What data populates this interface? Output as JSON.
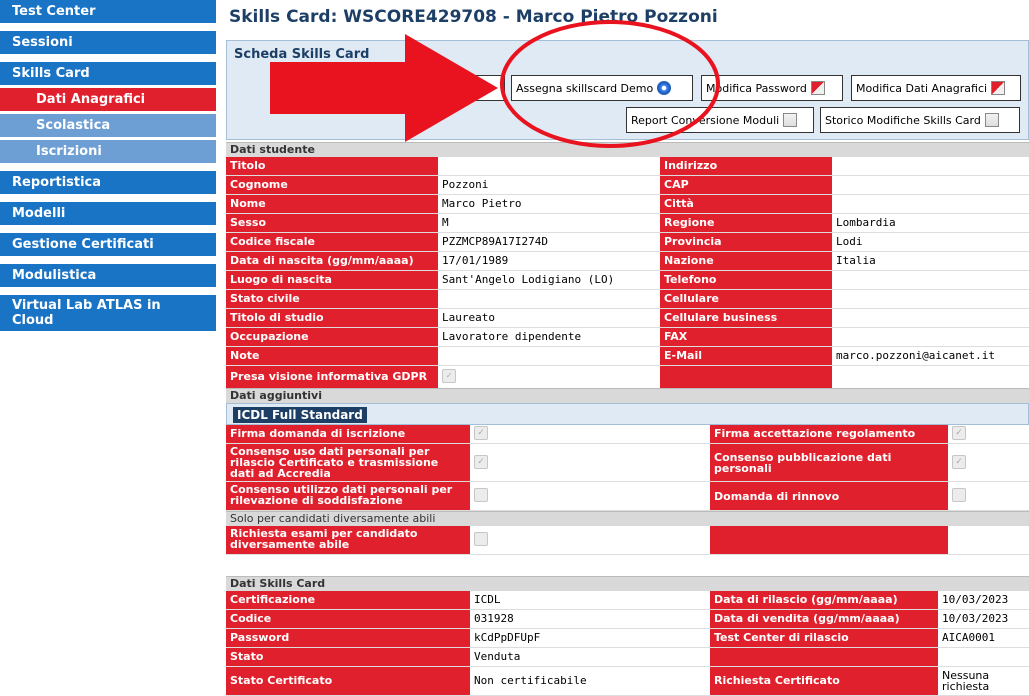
{
  "sidebar": {
    "items": [
      {
        "label": "Test Center"
      },
      {
        "label": "Sessioni"
      },
      {
        "label": "Skills Card"
      },
      {
        "label": "Dati Anagrafici"
      },
      {
        "label": "Scolastica"
      },
      {
        "label": "Iscrizioni"
      },
      {
        "label": "Reportistica"
      },
      {
        "label": "Modelli"
      },
      {
        "label": "Gestione Certificati"
      },
      {
        "label": "Modulistica"
      },
      {
        "label": "Virtual Lab ATLAS in Cloud"
      }
    ]
  },
  "page_title": "Skills Card: WSCORE429708 - Marco Pietro Pozzoni",
  "card": {
    "title": "Scheda Skills Card",
    "buttons": {
      "demo": "Assegna skillscard Demo",
      "password": "Modifica Password",
      "anagrafici": "Modifica Dati Anagrafici",
      "report": "Report Conversione Moduli",
      "storico": "Storico Modifiche Skills Card"
    }
  },
  "dati_studente": {
    "header": "Dati studente",
    "left": [
      {
        "label": "Titolo",
        "value": ""
      },
      {
        "label": "Cognome",
        "value": "Pozzoni"
      },
      {
        "label": "Nome",
        "value": "Marco Pietro"
      },
      {
        "label": "Sesso",
        "value": "M"
      },
      {
        "label": "Codice fiscale",
        "value": "PZZMCP89A17I274D"
      },
      {
        "label": "Data di nascita (gg/mm/aaaa)",
        "value": "17/01/1989"
      },
      {
        "label": "Luogo di nascita",
        "value": "Sant'Angelo Lodigiano (LO)"
      },
      {
        "label": "Stato civile",
        "value": ""
      },
      {
        "label": "Titolo di studio",
        "value": "Laureato"
      },
      {
        "label": "Occupazione",
        "value": "Lavoratore dipendente"
      },
      {
        "label": "Note",
        "value": ""
      }
    ],
    "right": [
      {
        "label": "Indirizzo",
        "value": ""
      },
      {
        "label": "CAP",
        "value": ""
      },
      {
        "label": "Città",
        "value": ""
      },
      {
        "label": "Regione",
        "value": "Lombardia"
      },
      {
        "label": "Provincia",
        "value": "Lodi"
      },
      {
        "label": "Nazione",
        "value": "Italia"
      },
      {
        "label": "Telefono",
        "value": ""
      },
      {
        "label": "Cellulare",
        "value": ""
      },
      {
        "label": "Cellulare business",
        "value": ""
      },
      {
        "label": "FAX",
        "value": ""
      },
      {
        "label": "E-Mail",
        "value": "marco.pozzoni@aicanet.it"
      }
    ],
    "gdpr_label": "Presa visione informativa GDPR"
  },
  "dati_aggiuntivi": {
    "header": "Dati aggiuntivi",
    "badge": "ICDL Full Standard",
    "rows": [
      {
        "left": "Firma domanda di iscrizione",
        "right": "Firma accettazione regolamento"
      },
      {
        "left": "Consenso uso dati personali per rilascio Certificato e trasmissione dati ad Accredia",
        "right": "Consenso pubblicazione dati personali"
      },
      {
        "left": "Consenso utilizzo dati personali per rilevazione di soddisfazione",
        "right": "Domanda di rinnovo"
      }
    ],
    "abili_header": "Solo per candidati diversamente abili",
    "abili_label": "Richiesta esami per candidato diversamente abile"
  },
  "dati_skills": {
    "header": "Dati Skills Card",
    "rows": [
      {
        "l": "Certificazione",
        "v": "ICDL",
        "r": "Data di rilascio (gg/mm/aaaa)",
        "rv": "10/03/2023"
      },
      {
        "l": "Codice",
        "v": "031928",
        "r": "Data di vendita (gg/mm/aaaa)",
        "rv": "10/03/2023"
      },
      {
        "l": "Password",
        "v": "kCdPpDFUpF",
        "r": "Test Center di rilascio",
        "rv": "AICA0001"
      },
      {
        "l": "Stato",
        "v": "Venduta",
        "r": "",
        "rv": ""
      },
      {
        "l": "Stato Certificato",
        "v": "Non certificabile",
        "r": "Richiesta Certificato",
        "rv": "Nessuna richiesta"
      }
    ]
  },
  "colors": {
    "nav": "#1a74c6",
    "active": "#e0212d",
    "label_bg": "#e0212d",
    "title": "#1d3f66",
    "annotation": "#e8131e"
  }
}
